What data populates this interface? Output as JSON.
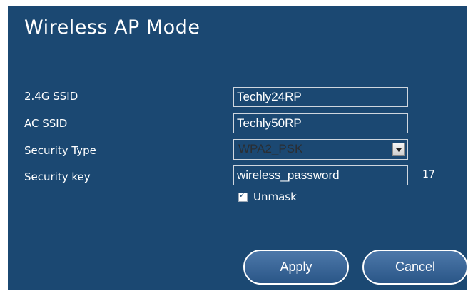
{
  "page": {
    "title": "Wireless AP Mode"
  },
  "form": {
    "ssid_24g": {
      "label": "2.4G SSID",
      "value": "Techly24RP"
    },
    "ac_ssid": {
      "label": "AC SSID",
      "value": "Techly50RP"
    },
    "security_type": {
      "label": "Security Type",
      "selected": "WPA2_PSK"
    },
    "security_key": {
      "label": "Security key",
      "value": "wireless_password",
      "length": "17"
    },
    "unmask": {
      "label": "Unmask",
      "checked": true
    }
  },
  "buttons": {
    "apply": "Apply",
    "cancel": "Cancel"
  },
  "colors": {
    "panel_background": "#1b4872",
    "button_top": "#4d78aa",
    "button_bottom": "#2a5687"
  }
}
